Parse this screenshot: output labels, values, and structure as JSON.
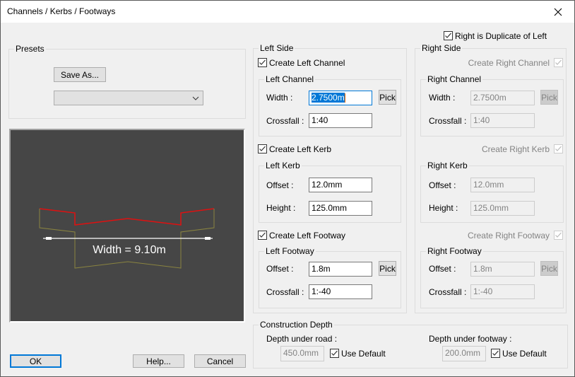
{
  "window": {
    "title": "Channels / Kerbs / Footways",
    "close_icon": "close-icon"
  },
  "presets": {
    "group_label": "Presets",
    "save_as_label": "Save As...",
    "dropdown_value": ""
  },
  "preview": {
    "width_label": "Width = 9.10m",
    "top_profile_color": "#e01010",
    "bottom_profile_color": "#8a8440",
    "dimension_line_color": "#ffffff",
    "background_color": "#464646"
  },
  "right_duplicate": {
    "label": "Right is Duplicate of Left",
    "checked": true
  },
  "left_side": {
    "group_label": "Left Side",
    "channel": {
      "checkbox_label": "Create Left Channel",
      "checked": true,
      "group_label": "Left Channel",
      "width_label": "Width :",
      "width_value": "2.7500m",
      "crossfall_label": "Crossfall :",
      "crossfall_value": "1:40",
      "pick_label": "Pick"
    },
    "kerb": {
      "checkbox_label": "Create Left Kerb",
      "checked": true,
      "group_label": "Left Kerb",
      "offset_label": "Offset :",
      "offset_value": "12.0mm",
      "height_label": "Height :",
      "height_value": "125.0mm"
    },
    "footway": {
      "checkbox_label": "Create Left Footway",
      "checked": true,
      "group_label": "Left Footway",
      "offset_label": "Offset :",
      "offset_value": "1.8m",
      "crossfall_label": "Crossfall :",
      "crossfall_value": "1:-40",
      "pick_label": "Pick"
    }
  },
  "right_side": {
    "group_label": "Right Side",
    "channel": {
      "checkbox_label": "Create Right Channel",
      "checked": true,
      "group_label": "Right Channel",
      "width_label": "Width :",
      "width_value": "2.7500m",
      "crossfall_label": "Crossfall :",
      "crossfall_value": "1:40",
      "pick_label": "Pick"
    },
    "kerb": {
      "checkbox_label": "Create Right Kerb",
      "checked": true,
      "group_label": "Right Kerb",
      "offset_label": "Offset :",
      "offset_value": "12.0mm",
      "height_label": "Height :",
      "height_value": "125.0mm"
    },
    "footway": {
      "checkbox_label": "Create Right Footway",
      "checked": true,
      "group_label": "Right Footway",
      "offset_label": "Offset :",
      "offset_value": "1.8m",
      "crossfall_label": "Crossfall :",
      "crossfall_value": "1:-40",
      "pick_label": "Pick"
    }
  },
  "construction_depth": {
    "group_label": "Construction Depth",
    "road_label": "Depth under road :",
    "road_value": "450.0mm",
    "road_use_default_label": "Use Default",
    "road_use_default_checked": true,
    "footway_label": "Depth under footway :",
    "footway_value": "200.0mm",
    "footway_use_default_label": "Use Default",
    "footway_use_default_checked": true
  },
  "buttons": {
    "ok": "OK",
    "help": "Help...",
    "cancel": "Cancel"
  }
}
